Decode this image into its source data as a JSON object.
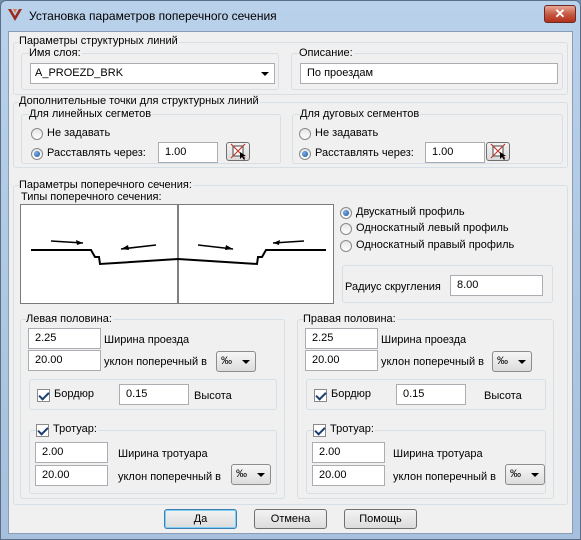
{
  "window": {
    "title": "Установка параметров поперечного сечения",
    "close": "✕"
  },
  "structural": {
    "group_label": "Параметры структурных линий",
    "layer_label": "Имя слоя:",
    "layer_value": "A_PROEZD_BRK",
    "desc_label": "Описание:",
    "desc_value": "По проездам"
  },
  "extra_points": {
    "group_label": "Дополнительные точки для структурных линий",
    "linear": {
      "label": "Для линейных сегметов",
      "opt_none": "Не задавать",
      "opt_every": "Расставлять через:",
      "value": "1.00",
      "selected": "every"
    },
    "arc": {
      "label": "Для дуговых сегментов",
      "opt_none": "Не задавать",
      "opt_every": "Расставлять через:",
      "value": "1.00",
      "selected": "every"
    }
  },
  "section": {
    "group_label": "Параметры поперечного сечения:",
    "types_label": "Типы поперечного сечения:",
    "profile_options": [
      "Двускатный профиль",
      "Односкатный левый профиль",
      "Односкатный правый профиль"
    ],
    "profile_selected": 0,
    "radius_label": "Радиус скругления",
    "radius_value": "8.00"
  },
  "left": {
    "label": "Левая половина:",
    "road_width": "2.25",
    "road_width_label": "Ширина проезда",
    "slope": "20.00",
    "slope_label": "уклон поперечный в",
    "slope_unit": "‰",
    "curb_label": "Бордюр",
    "curb_checked": true,
    "curb_value": "0.15",
    "curb_height_label": "Высота",
    "sidewalk_label": "Тротуар:",
    "sidewalk_checked": true,
    "sidewalk_width": "2.00",
    "sidewalk_width_label": "Ширина тротуара",
    "sidewalk_slope": "20.00",
    "sidewalk_slope_label": "уклон поперечный в",
    "sidewalk_slope_unit": "‰"
  },
  "right": {
    "label": "Правая половина:",
    "road_width": "2.25",
    "road_width_label": "Ширина проезда",
    "slope": "20.00",
    "slope_label": "уклон поперечный в",
    "slope_unit": "‰",
    "curb_label": "Бордюр",
    "curb_checked": true,
    "curb_value": "0.15",
    "curb_height_label": "Высота",
    "sidewalk_label": "Тротуар:",
    "sidewalk_checked": true,
    "sidewalk_width": "2.00",
    "sidewalk_width_label": "Ширина тротуара",
    "sidewalk_slope": "20.00",
    "sidewalk_slope_label": "уклон поперечный в",
    "sidewalk_slope_unit": "‰"
  },
  "buttons": {
    "ok": "Да",
    "cancel": "Отмена",
    "help": "Помощь"
  },
  "icons": {
    "app": "road-section-icon",
    "pick": "pick-point-icon",
    "close": "close-icon"
  },
  "colors": {
    "accent": "#3c7fb1",
    "title_bar": "#b9d1ea",
    "close_red": "#c75a44",
    "radio_dot": "#1a4f9c"
  }
}
